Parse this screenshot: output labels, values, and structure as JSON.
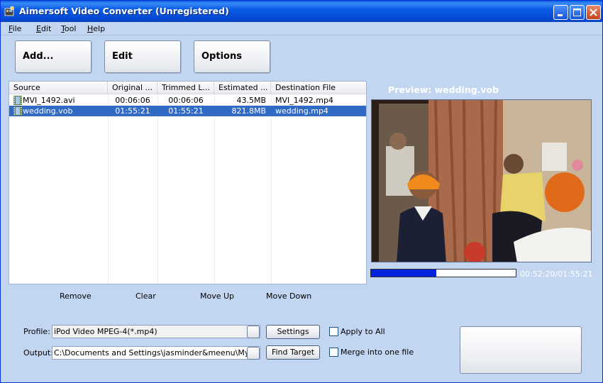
{
  "window": {
    "title": "Aimersoft Video Converter (Unregistered)"
  },
  "menu": [
    {
      "u": "F",
      "rest": "ile"
    },
    {
      "u": "E",
      "rest": "dit"
    },
    {
      "u": "T",
      "rest": "ool"
    },
    {
      "u": "H",
      "rest": "elp"
    }
  ],
  "toolbar": {
    "add_label": "Add...",
    "edit_label": "Edit",
    "options_label": "Options"
  },
  "list": {
    "columns": [
      "Source",
      "Original ...",
      "Trimmed L...",
      "Estimated ...",
      "Destination File"
    ],
    "rows": [
      {
        "source": "MVI_1492.avi",
        "original": "00:06:06",
        "trimmed": "00:06:06",
        "estimated": "43.5MB",
        "destination": "MVI_1492.mp4",
        "selected": false
      },
      {
        "source": "wedding.vob",
        "original": "01:55:21",
        "trimmed": "01:55:21",
        "estimated": "821.8MB",
        "destination": "wedding.mp4",
        "selected": true
      }
    ]
  },
  "actions": {
    "remove": "Remove",
    "clear": "Clear",
    "move_up": "Move Up",
    "move_down": "Move Down"
  },
  "preview": {
    "title": "Preview: wedding.vob",
    "time": "00:52:20/01:55:21",
    "progress": 0.45
  },
  "profile": {
    "label": "Profile:",
    "value": "iPod Video MPEG-4(*.mp4)",
    "settings_label": "Settings",
    "apply_all_label": "Apply to All"
  },
  "output": {
    "label": "Output:",
    "value": "C:\\Documents and Settings\\jasminder&meenu\\My Documents",
    "find_target_label": "Find Target",
    "merge_label": "Merge into one file"
  },
  "colors": {
    "accent": "#316ac5",
    "background": "#c3d6f1",
    "progress": "#0022dd"
  }
}
